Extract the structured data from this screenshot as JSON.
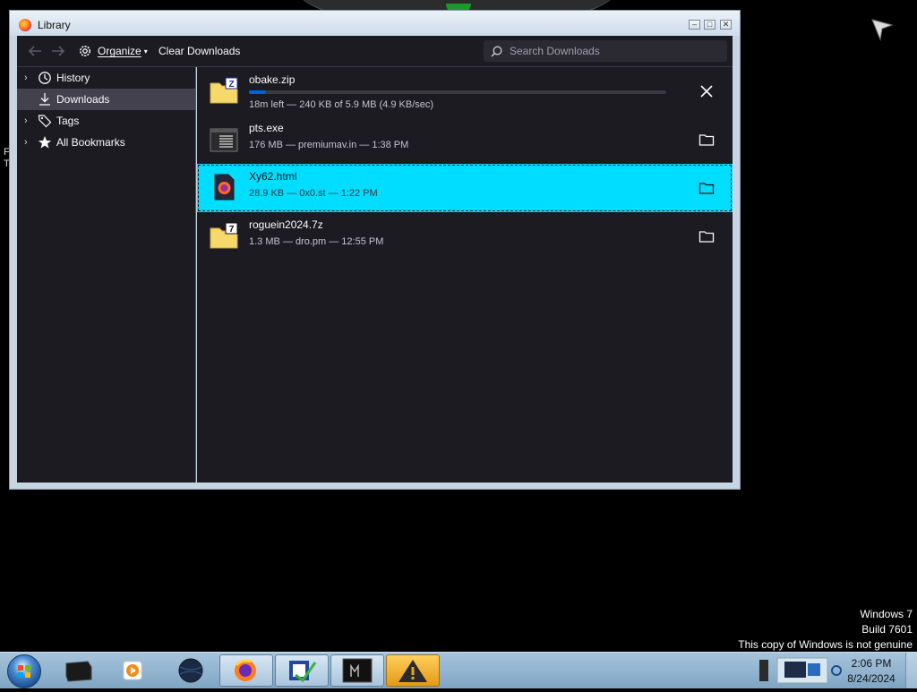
{
  "window": {
    "title": "Library",
    "controls": {
      "minimize": "–",
      "maximize": "□",
      "close": "✕"
    }
  },
  "toolbar": {
    "back_icon": "arrow-left-icon",
    "forward_icon": "arrow-right-icon",
    "organize_label": "Organize",
    "clear_downloads_label": "Clear Downloads",
    "search_placeholder": "Search Downloads",
    "search_value": ""
  },
  "sidebar": {
    "items": [
      {
        "label": "History",
        "icon": "clock-icon",
        "expandable": true,
        "selected": false
      },
      {
        "label": "Downloads",
        "icon": "download-icon",
        "expandable": false,
        "selected": true
      },
      {
        "label": "Tags",
        "icon": "tag-icon",
        "expandable": true,
        "selected": false
      },
      {
        "label": "All Bookmarks",
        "icon": "star-icon",
        "expandable": true,
        "selected": false
      }
    ]
  },
  "downloads": [
    {
      "name": "obake.zip",
      "status": "18m left — 240 KB of 5.9 MB (4.9 KB/sec)",
      "icon": "zip-archive-icon",
      "progress": 0.04,
      "action": "cancel-icon",
      "selected": false
    },
    {
      "name": "pts.exe",
      "status": "176 MB — premiumav.in — 1:38 PM",
      "icon": "executable-icon",
      "action": "folder-icon",
      "selected": false
    },
    {
      "name": "Xy62.html",
      "status": "28.9 KB — 0x0.st — 1:22 PM",
      "icon": "firefox-html-icon",
      "action": "folder-icon",
      "selected": true
    },
    {
      "name": "roguein2024.7z",
      "status": "1.3 MB — dro.pm — 12:55 PM",
      "icon": "7z-archive-icon",
      "action": "folder-icon",
      "selected": false
    }
  ],
  "desktop": {
    "left_fragment_line1": "F",
    "left_fragment_line2": "T"
  },
  "watermark": {
    "line1": "Windows 7",
    "line2": "Build 7601",
    "line3": "This copy of Windows is not genuine"
  },
  "taskbar": {
    "start_icon": "windows-start-orb-icon",
    "apps": [
      "dark-box-app-icon",
      "media-player-icon",
      "globe-app-icon",
      "firefox-icon",
      "checklist-app-icon",
      "terminal-app-icon",
      "warning-app-icon"
    ],
    "clock_time": "2:06 PM",
    "clock_date": "8/24/2024"
  },
  "colors": {
    "selection": "#00ddff",
    "panel_bg": "#1c1b22",
    "progress": "#0060df"
  }
}
